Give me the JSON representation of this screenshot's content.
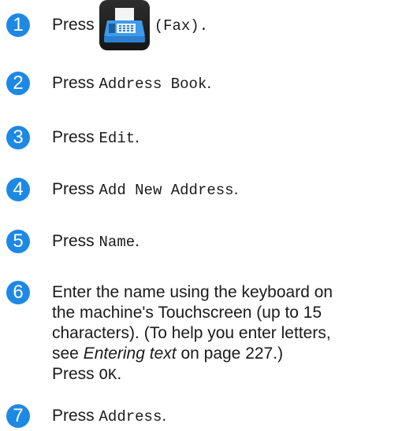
{
  "steps": [
    {
      "number": "1",
      "prefix": "Press",
      "code": "(Fax)."
    },
    {
      "number": "2",
      "prefix": "Press",
      "code": "Address Book",
      "suffix": "."
    },
    {
      "number": "3",
      "prefix": "Press",
      "code": "Edit",
      "suffix": "."
    },
    {
      "number": "4",
      "prefix": "Press",
      "code": "Add New Address",
      "suffix": "."
    },
    {
      "number": "5",
      "prefix": "Press",
      "code": "Name",
      "suffix": "."
    },
    {
      "number": "6",
      "line1": "Enter the name using the keyboard on",
      "line2": "the machine's Touchscreen (up to 15",
      "line3": "characters). (To help you enter letters,",
      "line4_pre": "see",
      "line4_link": "Entering text",
      "line4_post": "on page 227.)",
      "line5_prefix": "Press",
      "line5_code": "OK",
      "line5_suffix": "."
    },
    {
      "number": "7",
      "prefix": "Press",
      "code": "Address",
      "suffix": "."
    }
  ],
  "icon": "fax-machine-icon"
}
